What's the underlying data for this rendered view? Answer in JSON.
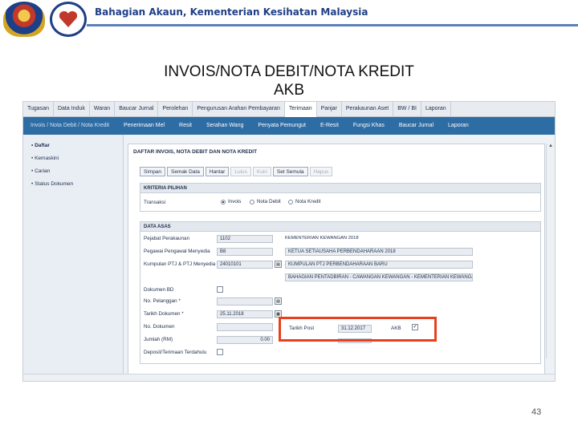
{
  "header": {
    "title": "Bahagian Akaun, Kementerian Kesihatan Malaysia"
  },
  "slide": {
    "title_line1": "INVOIS/NOTA DEBIT/NOTA KREDIT",
    "title_line2": "AKB",
    "page_number": "43"
  },
  "menu_top": [
    "Tugasan",
    "Data Induk",
    "Waran",
    "Baucar Jurnal",
    "Perolehan",
    "Pengurusan Arahan Pembayaran",
    "Terimaan",
    "Panjar",
    "Perakaunan Aset",
    "BW / BI",
    "Laporan"
  ],
  "menu_sub": [
    "Invois / Nota Debit / Nota Kredit",
    "Penerimaan Mel",
    "Resit",
    "Serahan Wang",
    "Penyata Pemungut",
    "E-Resit",
    "Fungsi Khas",
    "Baucar Jurnal",
    "Laporan"
  ],
  "sidebar": [
    "Daftar",
    "Kemaskini",
    "Carian",
    "Status Dokumen"
  ],
  "panel": {
    "title": "DAFTAR INVOIS, NOTA DEBIT DAN NOTA KREDIT"
  },
  "toolbar": {
    "simpan": "Simpan",
    "semak": "Semak Data",
    "hantar": "Hantar",
    "lulus": "Lulus",
    "kuiri": "Kuiri",
    "setsemula": "Set Semula",
    "hapus": "Hapus"
  },
  "kriteria": {
    "header": "KRITERIA PILIHAN",
    "transaksi_label": "Transaksi",
    "options": [
      "Invois",
      "Nota Debit",
      "Nota Kredit"
    ]
  },
  "data_asas": {
    "header": "DATA ASAS",
    "pejabat_label": "Pejabat Perakaunan",
    "pejabat_code": "1102",
    "pejabat_name": "KEMENTERIAN KEWANGAN 2018",
    "pegawai_label": "Pegawai Pengawal Menyedia",
    "pegawai_code": "B8",
    "pegawai_name": "KETUA SETIAUSAHA PERBENDAHARAAN 2018",
    "ptj_label": "Kumpulan PTJ & PTJ Menyedia *",
    "ptj_code": "24010101",
    "ptj_name1": "KUMPULAN PTJ PERBENDAHARAAN BARU",
    "ptj_name2": "BAHAGIAN PENTADBIRAN - CAWANGAN KEWANGAN - KEMENTERIAN KEWANGAN",
    "dokumen_bd_label": "Dokumen BD",
    "no_pelanggan_label": "No. Pelanggan *",
    "tarikh_dokumen_label": "Tarikh Dokumen *",
    "tarikh_dokumen_value": "25.11.2018",
    "no_dokumen_label": "No. Dokumen",
    "jumlah_label": "Jumlah (RM)",
    "jumlah_value": "0.00",
    "deposit_label": "Deposit/Terimaan Terdahulu",
    "tarikh_post_label": "Tarikh Post",
    "tarikh_post_value": "31.12.2017",
    "akb_label": "AKB"
  }
}
